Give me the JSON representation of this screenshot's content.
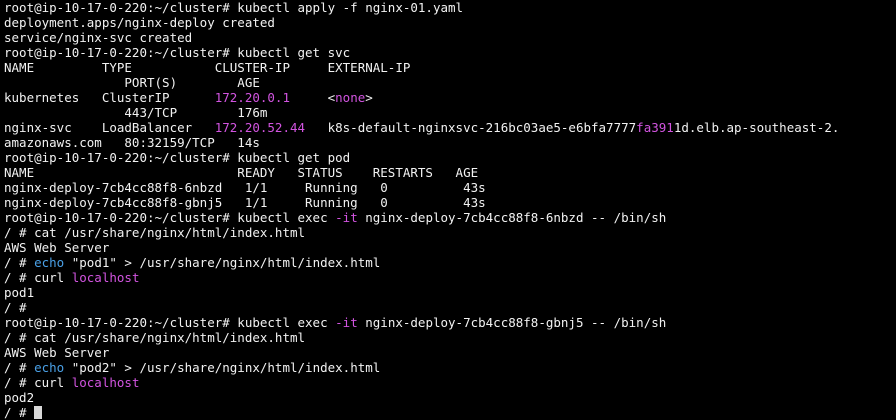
{
  "terminal": {
    "colors": {
      "background": "#000000",
      "foreground": "#f2f2f2",
      "magenta": "#d254e0",
      "blue": "#4aa0e6",
      "cursor": "#d8d8d8"
    },
    "lines": [
      {
        "segments": [
          {
            "text": "root@ip-10-17-0-220:~/cluster# kubectl apply -f nginx-01.yaml",
            "color": "default"
          }
        ]
      },
      {
        "segments": [
          {
            "text": "deployment.apps/nginx-deploy created",
            "color": "default"
          }
        ]
      },
      {
        "segments": [
          {
            "text": "service/nginx-svc created",
            "color": "default"
          }
        ]
      },
      {
        "segments": [
          {
            "text": "root@ip-10-17-0-220:~/cluster# kubectl get svc",
            "color": "default"
          }
        ]
      },
      {
        "segments": [
          {
            "text": "NAME         TYPE           CLUSTER-IP     EXTERNAL-IP",
            "color": "default"
          }
        ]
      },
      {
        "segments": [
          {
            "text": "                PORT(S)        AGE",
            "color": "default"
          }
        ]
      },
      {
        "segments": [
          {
            "text": "kubernetes   ClusterIP      ",
            "color": "default"
          },
          {
            "text": "172.20.0.1",
            "color": "magenta"
          },
          {
            "text": "     <",
            "color": "default"
          },
          {
            "text": "none",
            "color": "magenta"
          },
          {
            "text": ">",
            "color": "default"
          }
        ]
      },
      {
        "segments": [
          {
            "text": "                443/TCP        176m",
            "color": "default"
          }
        ]
      },
      {
        "segments": [
          {
            "text": "nginx-svc    LoadBalancer   ",
            "color": "default"
          },
          {
            "text": "172.20.52.44",
            "color": "magenta"
          },
          {
            "text": "   k8s-default-nginxsvc-216bc03ae5-e6bfa7777",
            "color": "default"
          },
          {
            "text": "fa391",
            "color": "magenta"
          },
          {
            "text": "1d.elb.ap-southeast-2.",
            "color": "default"
          }
        ]
      },
      {
        "segments": [
          {
            "text": "amazonaws.com   80:32159/TCP   14s",
            "color": "default"
          }
        ]
      },
      {
        "segments": [
          {
            "text": "root@ip-10-17-0-220:~/cluster# kubectl get pod",
            "color": "default"
          }
        ]
      },
      {
        "segments": [
          {
            "text": "NAME                           READY   STATUS    RESTARTS   AGE",
            "color": "default"
          }
        ]
      },
      {
        "segments": [
          {
            "text": "nginx-deploy-7cb4cc88f8-6nbzd   1/1     Running   0          43s",
            "color": "default"
          }
        ]
      },
      {
        "segments": [
          {
            "text": "nginx-deploy-7cb4cc88f8-gbnj5   1/1     Running   0          43s",
            "color": "default"
          }
        ]
      },
      {
        "segments": [
          {
            "text": "root@ip-10-17-0-220:~/cluster# kubectl exec ",
            "color": "default"
          },
          {
            "text": "-it",
            "color": "magenta"
          },
          {
            "text": " nginx-deploy-7cb4cc88f8-6nbzd -- /bin/sh",
            "color": "default"
          }
        ]
      },
      {
        "segments": [
          {
            "text": "/ # cat /usr/share/nginx/html/index.html",
            "color": "default"
          }
        ]
      },
      {
        "segments": [
          {
            "text": "AWS Web Server",
            "color": "default"
          }
        ]
      },
      {
        "segments": [
          {
            "text": "/ # ",
            "color": "default"
          },
          {
            "text": "echo",
            "color": "blue"
          },
          {
            "text": " \"pod1\" > /usr/share/nginx/html/index.html",
            "color": "default"
          }
        ]
      },
      {
        "segments": [
          {
            "text": "/ # curl ",
            "color": "default"
          },
          {
            "text": "localhost",
            "color": "magenta"
          }
        ]
      },
      {
        "segments": [
          {
            "text": "pod1",
            "color": "default"
          }
        ]
      },
      {
        "segments": [
          {
            "text": "/ #",
            "color": "default"
          }
        ]
      },
      {
        "segments": [
          {
            "text": "root@ip-10-17-0-220:~/cluster# kubectl exec ",
            "color": "default"
          },
          {
            "text": "-it",
            "color": "magenta"
          },
          {
            "text": " nginx-deploy-7cb4cc88f8-gbnj5 -- /bin/sh",
            "color": "default"
          }
        ]
      },
      {
        "segments": [
          {
            "text": "/ # cat /usr/share/nginx/html/index.html",
            "color": "default"
          }
        ]
      },
      {
        "segments": [
          {
            "text": "AWS Web Server",
            "color": "default"
          }
        ]
      },
      {
        "segments": [
          {
            "text": "/ # ",
            "color": "default"
          },
          {
            "text": "echo",
            "color": "blue"
          },
          {
            "text": " \"pod2\" > /usr/share/nginx/html/index.html",
            "color": "default"
          }
        ]
      },
      {
        "segments": [
          {
            "text": "/ # curl ",
            "color": "default"
          },
          {
            "text": "localhost",
            "color": "magenta"
          }
        ]
      },
      {
        "segments": [
          {
            "text": "pod2",
            "color": "default"
          }
        ]
      },
      {
        "segments": [
          {
            "text": "/ # ",
            "color": "default"
          }
        ],
        "cursor": true
      }
    ]
  }
}
